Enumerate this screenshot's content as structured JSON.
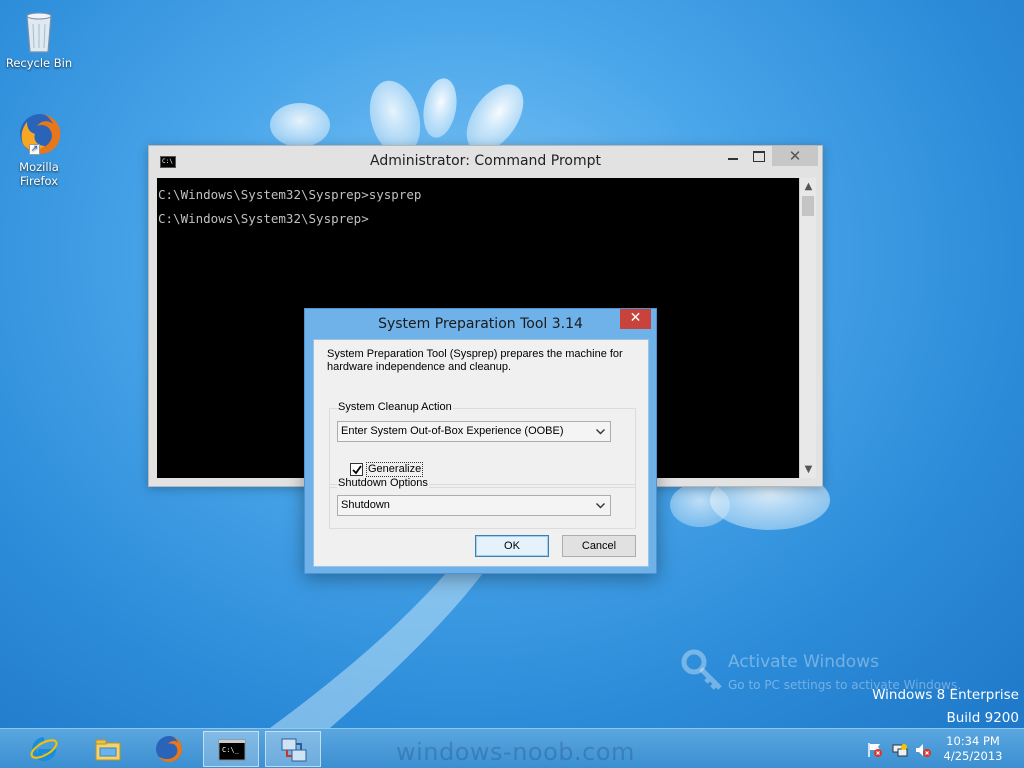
{
  "desktop": {
    "icons": [
      {
        "label": "Recycle Bin"
      },
      {
        "label": "Mozilla Firefox"
      }
    ],
    "activation": {
      "title": "Activate Windows",
      "subtitle": "Go to PC settings to activate Windows."
    },
    "edition": {
      "line1": "Windows 8 Enterprise",
      "line2": "Build 9200"
    }
  },
  "cmd_window": {
    "title": "Administrator: Command Prompt",
    "close_glyph": "✕",
    "lines": [
      "C:\\Windows\\System32\\Sysprep>sysprep",
      "C:\\Windows\\System32\\Sysprep>"
    ]
  },
  "sysprep_dialog": {
    "title": "System Preparation Tool 3.14",
    "close_glyph": "✕",
    "description": "System Preparation Tool (Sysprep) prepares the machine for hardware independence and cleanup.",
    "cleanup_group_label": "System Cleanup Action",
    "cleanup_selected": "Enter System Out-of-Box Experience (OOBE)",
    "generalize_label": "Generalize",
    "generalize_checked": true,
    "shutdown_group_label": "Shutdown Options",
    "shutdown_selected": "Shutdown",
    "ok_label": "OK",
    "cancel_label": "Cancel"
  },
  "taskbar": {
    "apps": [
      "internet-explorer-icon",
      "file-explorer-icon",
      "firefox-icon",
      "command-prompt-icon",
      "sysprep-icon"
    ],
    "watermark": "windows-noob.com",
    "clock_time": "10:34 PM",
    "clock_date": "4/25/2013"
  }
}
